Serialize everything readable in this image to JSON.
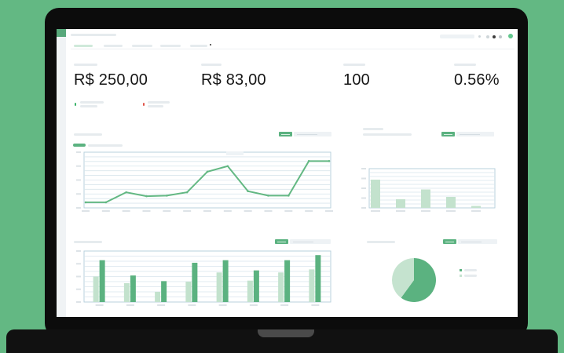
{
  "kpis": {
    "revenue": "R$ 250,00",
    "average": "R$ 83,00",
    "count": "100",
    "rate": "0.56%"
  },
  "colors": {
    "accent": "#63b883",
    "bar_dark": "#5bb280",
    "bar_light": "#c3e2cd",
    "pie_light": "#c5e3cf"
  },
  "icons": [
    "up-arrow-icon",
    "down-arrow-icon",
    "search-icon",
    "bell-icon",
    "gear-icon",
    "close-icon"
  ],
  "chart_data": [
    {
      "type": "line",
      "x": [
        1,
        2,
        3,
        4,
        5,
        6,
        7,
        8,
        9,
        10,
        11,
        12,
        13
      ],
      "series": [
        {
          "values": [
            10,
            10,
            28,
            21,
            22,
            28,
            65,
            75,
            30,
            22,
            22,
            84,
            84
          ]
        }
      ],
      "ylim": [
        0,
        100
      ],
      "grid": true
    },
    {
      "type": "bar",
      "categories": [
        "1",
        "2",
        "3",
        "4",
        "5"
      ],
      "values": [
        72,
        22,
        47,
        28,
        5
      ],
      "ylim": [
        0,
        100
      ],
      "grid": true
    },
    {
      "type": "bar",
      "categories": [
        "1",
        "2",
        "3",
        "4",
        "5",
        "6",
        "7",
        "8"
      ],
      "series": [
        {
          "values": [
            50,
            37,
            20,
            40,
            58,
            42,
            58,
            64
          ]
        },
        {
          "values": [
            82,
            52,
            41,
            77,
            82,
            62,
            82,
            92
          ]
        }
      ],
      "ylim": [
        0,
        100
      ],
      "grid": true
    },
    {
      "type": "pie",
      "values": [
        60,
        40
      ]
    }
  ]
}
